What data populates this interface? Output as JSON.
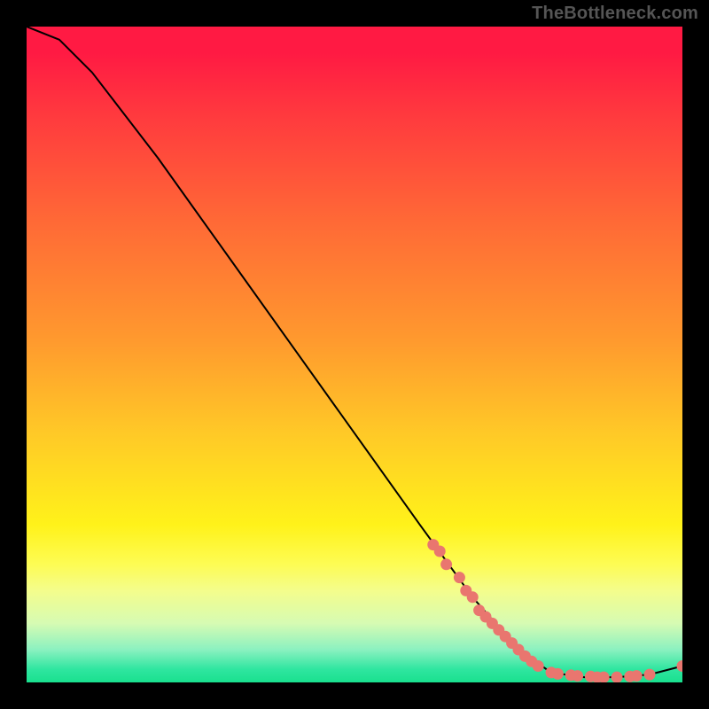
{
  "watermark": "TheBottleneck.com",
  "chart_data": {
    "type": "line",
    "title": "",
    "xlabel": "",
    "ylabel": "",
    "xlim": [
      0,
      100
    ],
    "ylim": [
      0,
      100
    ],
    "curve": {
      "name": "bottleneck-curve",
      "points": [
        {
          "x": 0,
          "y": 100
        },
        {
          "x": 5,
          "y": 98
        },
        {
          "x": 10,
          "y": 93
        },
        {
          "x": 20,
          "y": 80
        },
        {
          "x": 30,
          "y": 66
        },
        {
          "x": 40,
          "y": 52
        },
        {
          "x": 50,
          "y": 38
        },
        {
          "x": 60,
          "y": 24
        },
        {
          "x": 68,
          "y": 13
        },
        {
          "x": 75,
          "y": 5
        },
        {
          "x": 80,
          "y": 1.5
        },
        {
          "x": 85,
          "y": 0.8
        },
        {
          "x": 90,
          "y": 0.8
        },
        {
          "x": 95,
          "y": 1.2
        },
        {
          "x": 100,
          "y": 2.5
        }
      ]
    },
    "markers": [
      {
        "x": 62,
        "y": 21
      },
      {
        "x": 63,
        "y": 20
      },
      {
        "x": 64,
        "y": 18
      },
      {
        "x": 66,
        "y": 16
      },
      {
        "x": 67,
        "y": 14
      },
      {
        "x": 68,
        "y": 13
      },
      {
        "x": 69,
        "y": 11
      },
      {
        "x": 70,
        "y": 10
      },
      {
        "x": 71,
        "y": 9
      },
      {
        "x": 72,
        "y": 8
      },
      {
        "x": 73,
        "y": 7
      },
      {
        "x": 74,
        "y": 6
      },
      {
        "x": 75,
        "y": 5
      },
      {
        "x": 76,
        "y": 4
      },
      {
        "x": 77,
        "y": 3.2
      },
      {
        "x": 78,
        "y": 2.5
      },
      {
        "x": 80,
        "y": 1.5
      },
      {
        "x": 81,
        "y": 1.3
      },
      {
        "x": 83,
        "y": 1.1
      },
      {
        "x": 84,
        "y": 1.0
      },
      {
        "x": 86,
        "y": 0.9
      },
      {
        "x": 87,
        "y": 0.8
      },
      {
        "x": 88,
        "y": 0.8
      },
      {
        "x": 90,
        "y": 0.8
      },
      {
        "x": 92,
        "y": 0.9
      },
      {
        "x": 93,
        "y": 1.0
      },
      {
        "x": 95,
        "y": 1.2
      },
      {
        "x": 100,
        "y": 2.5
      }
    ],
    "marker_color": "#e9766f",
    "curve_color": "#000000"
  }
}
